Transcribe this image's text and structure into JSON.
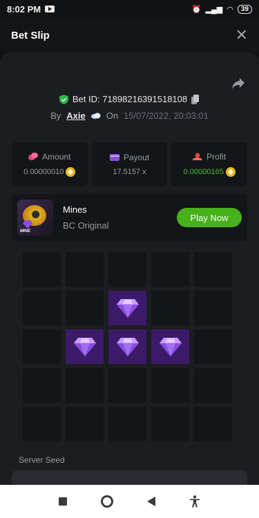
{
  "status_bar": {
    "time": "8:02 PM",
    "battery": "39"
  },
  "header": {
    "title": "Bet Slip",
    "close_label": "✕"
  },
  "bet": {
    "id_label": "Bet ID: 71898216391518108",
    "by_label": "By",
    "username": "Axie",
    "on_label": "On",
    "date": "15/07/2022, 20:03:01"
  },
  "stats": {
    "amount": {
      "label": "Amount",
      "value": "0.00000010"
    },
    "payout": {
      "label": "Payout",
      "value": "17.5157 x"
    },
    "profit": {
      "label": "Profit",
      "value": "0.00000165"
    }
  },
  "game": {
    "name": "Mines",
    "subtitle": "BC Original",
    "play_label": "Play Now",
    "thumb_label": "MINE"
  },
  "grid": {
    "rows": [
      [
        0,
        0,
        0,
        0,
        0
      ],
      [
        0,
        0,
        1,
        0,
        0
      ],
      [
        0,
        1,
        1,
        1,
        0
      ],
      [
        0,
        0,
        0,
        0,
        0
      ],
      [
        0,
        0,
        0,
        0,
        0
      ]
    ]
  },
  "server_seed": {
    "label": "Server Seed"
  },
  "colors": {
    "accent_green": "#46b11a",
    "profit_green": "#45c332",
    "gem_purple": "#8a4dde",
    "revealed_cell": "#3c1a6a"
  },
  "icons": {
    "shield": "shield-check-icon",
    "copy": "copy-icon",
    "share": "share-icon",
    "amount": "coins-icon",
    "payout": "wallet-icon",
    "profit": "profit-hand-icon",
    "coin": "bcd-coin-icon",
    "gem": "diamond-icon"
  }
}
